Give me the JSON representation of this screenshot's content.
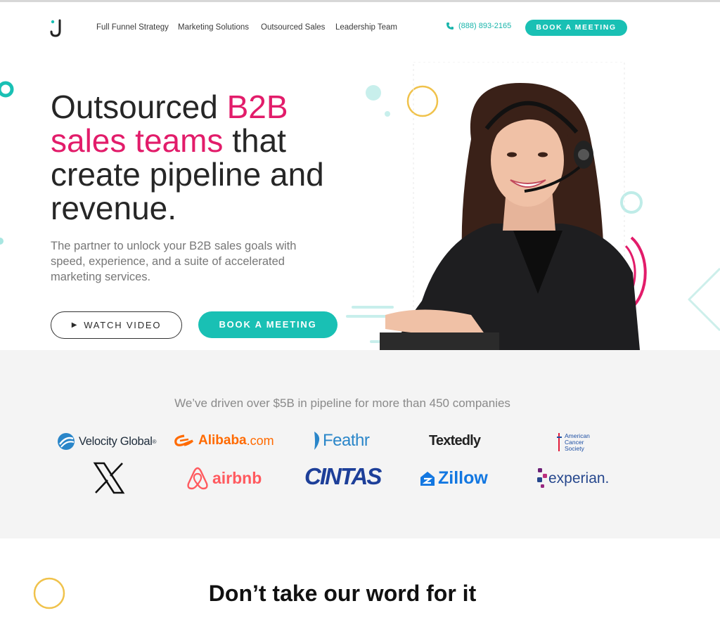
{
  "nav": {
    "links": [
      "Full Funnel Strategy",
      "Marketing Solutions",
      "Outsourced Sales",
      "Leadership Team"
    ],
    "phone": "(888) 893-2165",
    "cta": "BOOK A MEETING"
  },
  "hero": {
    "title_part1": "Outsourced ",
    "title_highlight1": "B2B",
    "title_highlight2": "sales teams",
    "title_part2": " that create pipeline and revenue.",
    "subtitle": "The partner to unlock your B2B sales goals with speed, experience, and a suite of accelerated marketing services.",
    "watch_label": "WATCH VIDEO",
    "book_label": "BOOK A MEETING"
  },
  "logos": {
    "heading": "We’ve driven over $5B in pipeline for more than 450 companies",
    "row1": {
      "velocity": "Velocity Global",
      "velocity_tm": "®",
      "alibaba_main": "Alibaba",
      "alibaba_suffix": ".com",
      "feathr": "Feathr",
      "textedly": "Textedly",
      "acs_1": "American",
      "acs_2": "Cancer",
      "acs_3": "Society"
    },
    "row2": {
      "x": "X",
      "airbnb": "airbnb",
      "cintas": "CINTAS",
      "zillow": "Zillow",
      "experian": "experian."
    }
  },
  "section2": {
    "title": "Don’t take our word for it"
  },
  "colors": {
    "teal": "#19c0b4",
    "pink": "#e21c6a",
    "gold": "#f0c24b"
  }
}
